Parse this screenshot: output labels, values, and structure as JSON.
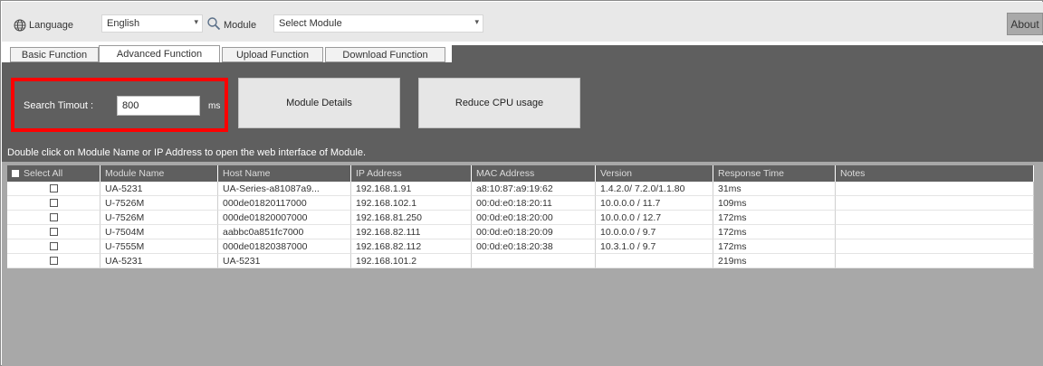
{
  "toolbar": {
    "language_label": "Language",
    "language_value": "English",
    "module_label": "Module",
    "module_value": "Select Module",
    "about_label": "About"
  },
  "tabs": [
    {
      "label": "Basic Function",
      "active": false
    },
    {
      "label": "Advanced Function",
      "active": true
    },
    {
      "label": "Upload Function",
      "active": false
    },
    {
      "label": "Download Function",
      "active": false
    }
  ],
  "panel": {
    "search_timeout_label": "Search Timout :",
    "search_timeout_value": "800",
    "search_timeout_unit": "ms",
    "module_details_label": "Module Details",
    "reduce_cpu_label": "Reduce CPU usage",
    "highlight_color": "#ff0000"
  },
  "hint": "Double click on Module Name or IP Address to open the web interface of Module.",
  "table": {
    "headers": [
      "Select All",
      "Module Name",
      "Host Name",
      "IP Address",
      "MAC Address",
      "Version",
      "Response Time",
      "Notes"
    ],
    "rows": [
      {
        "module": "UA-5231",
        "host": "UA-Series-a81087a9...",
        "ip": "192.168.1.91",
        "mac": "a8:10:87:a9:19:62",
        "version": "1.4.2.0/ 7.2.0/1.1.80",
        "response": "31ms",
        "notes": ""
      },
      {
        "module": "U-7526M",
        "host": "000de01820117000",
        "ip": "192.168.102.1",
        "mac": "00:0d:e0:18:20:11",
        "version": "10.0.0.0 / 11.7",
        "response": "109ms",
        "notes": ""
      },
      {
        "module": "U-7526M",
        "host": "000de01820007000",
        "ip": "192.168.81.250",
        "mac": "00:0d:e0:18:20:00",
        "version": "10.0.0.0 / 12.7",
        "response": "172ms",
        "notes": ""
      },
      {
        "module": "U-7504M",
        "host": "aabbc0a851fc7000",
        "ip": "192.168.82.111",
        "mac": "00:0d:e0:18:20:09",
        "version": "10.0.0.0 / 9.7",
        "response": "172ms",
        "notes": ""
      },
      {
        "module": "U-7555M",
        "host": "000de01820387000",
        "ip": "192.168.82.112",
        "mac": "00:0d:e0:18:20:38",
        "version": "10.3.1.0 / 9.7",
        "response": "172ms",
        "notes": ""
      },
      {
        "module": "UA-5231",
        "host": "UA-5231",
        "ip": "192.168.101.2",
        "mac": "",
        "version": "",
        "response": "219ms",
        "notes": ""
      }
    ]
  },
  "icons": {
    "language": "globe-icon",
    "module": "search-icon"
  }
}
